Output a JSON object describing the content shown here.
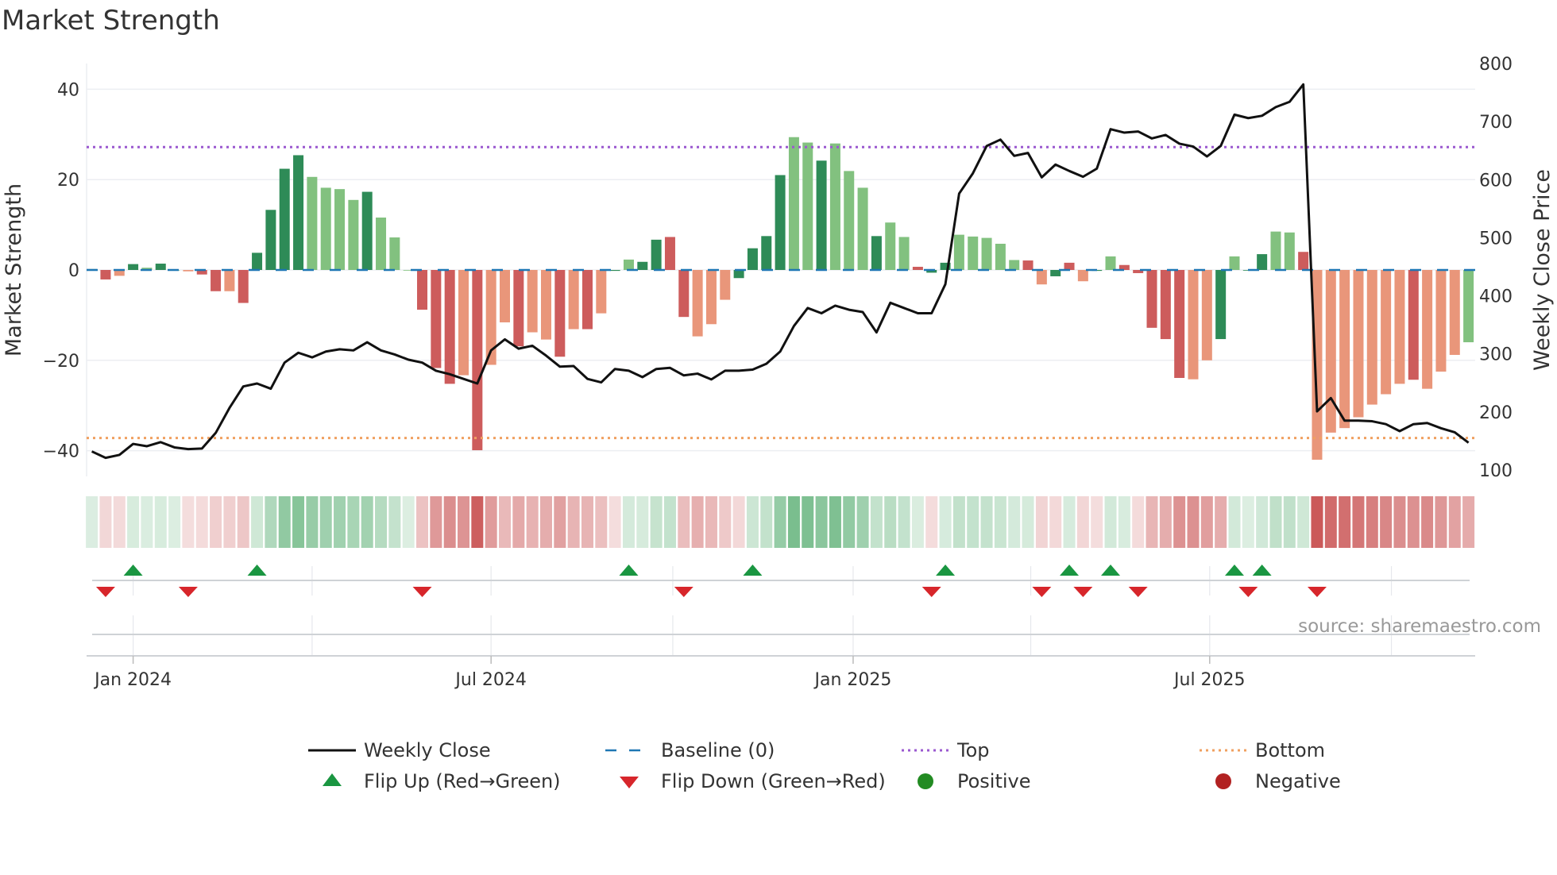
{
  "chart_data": {
    "type": "bar",
    "title": "Market Strength",
    "ylabel": "Market Strength",
    "y2label": "Weekly Close Price",
    "ylim": [
      -46,
      46
    ],
    "y2lim": [
      50,
      845
    ],
    "yticks": [
      -40,
      -20,
      0,
      20,
      40
    ],
    "y2ticks": [
      100,
      200,
      300,
      400,
      500,
      600,
      700,
      800
    ],
    "xticks": [
      {
        "label": "Jan 2024",
        "week": 3
      },
      {
        "label": "Jul 2024",
        "week": 29
      },
      {
        "label": "Jan 2025",
        "week": 55.3
      },
      {
        "label": "Jul 2025",
        "week": 81.2
      }
    ],
    "quarter_weeks": [
      3,
      16,
      29,
      42.2,
      55.3,
      68.2,
      81.2,
      94.4
    ],
    "top_level": 27.2,
    "bottom_level": -37.2,
    "baseline": 0,
    "strength": [
      0.2,
      -2.1,
      -1.3,
      1.3,
      0.5,
      1.4,
      0,
      -0.3,
      -1,
      -4.7,
      -4.7,
      -7.3,
      3.8,
      13.3,
      22.4,
      25.4,
      20.6,
      18.2,
      17.9,
      15.5,
      17.3,
      11.6,
      7.2,
      0,
      -8.8,
      -21.7,
      -25.2,
      -23.3,
      -39.9,
      -21,
      -11.6,
      -16.9,
      -13.8,
      -15.4,
      -19.2,
      -13.1,
      -13.1,
      -9.6,
      -0.2,
      2.3,
      1.8,
      6.7,
      7.3,
      -10.4,
      -14.7,
      -12,
      -6.6,
      -1.8,
      4.8,
      7.5,
      21,
      29.4,
      28.2,
      24.2,
      28,
      21.9,
      18.2,
      7.5,
      10.5,
      7.3,
      0.7,
      -0.6,
      1.6,
      7.8,
      7.4,
      7.1,
      5.8,
      2.2,
      2.1,
      -3.2,
      -1.4,
      1.6,
      -2.5,
      -0.2,
      3,
      1.1,
      -0.7,
      -12.8,
      -15.3,
      -23.9,
      -24.2,
      -20,
      -15.3,
      3,
      0,
      3.5,
      8.5,
      8.3,
      4,
      -42,
      -36,
      -35,
      -32.6,
      -29.8,
      -27.5,
      -25.2,
      -24.3,
      -26.3,
      -22.5,
      -18.8,
      -16
    ],
    "bar_shade": "SRWSLSLWRRWRSSSSLLLLSLLLRRRWRWWRWWRWRWSLSSRRWWWSSSSLLSLLLSLLRSSLLLLLRWSRWSLRRRRRWWSLSSLLRWWWWWWWRWWW",
    "weekly_close": [
      132,
      121,
      126,
      145,
      141,
      148,
      139,
      136,
      137,
      164,
      207,
      244,
      249,
      240,
      285,
      302,
      294,
      304,
      308,
      306,
      320,
      306,
      299,
      290,
      285,
      271,
      265,
      257,
      249,
      306,
      325,
      309,
      314,
      297,
      278,
      279,
      257,
      251,
      274,
      271,
      260,
      274,
      276,
      263,
      266,
      256,
      271,
      271,
      273,
      283,
      304,
      348,
      379,
      370,
      383,
      376,
      372,
      337,
      388,
      379,
      370,
      370,
      420,
      576,
      611,
      658,
      669,
      641,
      646,
      604,
      626,
      615,
      605,
      619,
      687,
      681,
      683,
      671,
      677,
      662,
      657,
      640,
      658,
      712,
      706,
      710,
      725,
      734,
      764,
      201,
      224,
      185,
      185,
      184,
      179,
      167,
      179,
      181,
      172,
      165,
      147
    ],
    "flip_up_weeks": [
      3,
      12,
      39,
      48,
      62,
      71,
      74,
      83,
      85
    ],
    "flip_down_weeks": [
      1,
      7,
      24,
      43,
      61,
      69,
      72,
      76,
      84,
      89
    ],
    "colors": {
      "strong_pos": "#2e8b57",
      "weak_pos": "#82c17f",
      "strong_neg": "#cd5c5c",
      "weak_neg": "#e9967a",
      "close": "#111111",
      "baseline": "#1f77b4",
      "top": "#9b59d0",
      "bottom": "#f0a060",
      "flip_up": "#1a9641",
      "flip_down": "#d7262b",
      "positive": "#228b22",
      "negative": "#b22222"
    },
    "legend": [
      {
        "label": "Weekly Close",
        "kind": "line"
      },
      {
        "label": "Baseline (0)",
        "kind": "dash"
      },
      {
        "label": "Top",
        "kind": "dotTop"
      },
      {
        "label": "Bottom",
        "kind": "dotBottom"
      },
      {
        "label": "Flip Up (Red→Green)",
        "kind": "up"
      },
      {
        "label": "Flip Down (Green→Red)",
        "kind": "down"
      },
      {
        "label": "Positive",
        "kind": "pos"
      },
      {
        "label": "Negative",
        "kind": "neg"
      }
    ],
    "source": "source: sharemaestro.com"
  }
}
